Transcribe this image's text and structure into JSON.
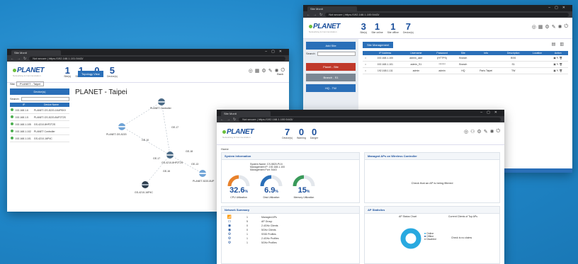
{
  "window1": {
    "tab_title": "Site Monit",
    "url": "Not secure | https://192.168.1.101:5443/",
    "logo": "PLANET",
    "logo_sub": "Networking & Communication",
    "stats": [
      {
        "num": "1",
        "label": "Site(s)"
      },
      {
        "num": "1",
        "label": "Site online"
      },
      {
        "num": "0",
        "label": "Site offline"
      },
      {
        "num": "5",
        "label": "Device(s)"
      }
    ],
    "topology_tab": "Topology View",
    "back_label": "Back",
    "site_label": "Site",
    "site_select": "PLANET - Taipei",
    "device_button": "Device(s)",
    "search_label": "Search",
    "table_headers": [
      "",
      "IP",
      "Device Name"
    ],
    "devices": [
      {
        "ip": "192.168.1.6",
        "name": "PLANET-GS-5220-16UP8XV"
      },
      {
        "ip": "192.168.1.5",
        "name": "PLANET-GS-5220-8UP2T2S"
      },
      {
        "ip": "192.168.1.105",
        "name": "GS-4210-8HP2T2S"
      },
      {
        "ip": "192.168.1.102",
        "name": "PLANET Controller"
      },
      {
        "ip": "192.168.1.101",
        "name": "GS-4210-16P4C"
      }
    ],
    "site_title": "PLANET - Taipei",
    "topo_nodes": [
      "PLANET-Controller",
      "PLANET-GS-5220",
      "GS-4210-8HP2T2S",
      "GS-4210-16P4C",
      "PLANET-5220-8UP"
    ],
    "topo_ports": [
      "GE-17",
      "GE-10",
      "GE-18",
      "GE-17",
      "GE-13",
      "GE-16"
    ]
  },
  "window2": {
    "tab_title": "Site Monit",
    "url": "Not secure | https://192.168.1.100:5443/",
    "logo": "PLANET",
    "logo_sub": "Networking & Communication",
    "stats": [
      {
        "num": "3",
        "label": "Site(s)"
      },
      {
        "num": "1",
        "label": "Site online"
      },
      {
        "num": "1",
        "label": "Site offline"
      },
      {
        "num": "7",
        "label": "Device(s)"
      }
    ],
    "side_add": "Add Site",
    "side_search": "Search",
    "side_buttons": [
      {
        "label": "Planet - Site",
        "color": "#c0392b"
      },
      {
        "label": "Branch - S1",
        "color": "#7b8794"
      },
      {
        "label": "HQ - TW",
        "color": "#2a6fb8"
      }
    ],
    "mgmt_tab": "Site Management",
    "table_headers": [
      "",
      "IP Address",
      "Username",
      "Password",
      "Site",
      "Info",
      "Description",
      "Location",
      "Action"
    ],
    "rows": [
      [
        "",
        "192.168.1.100",
        "admin_user",
        "(HTTPS)",
        "Branch",
        "",
        "BSS",
        "",
        ""
      ],
      [
        "",
        "192.168.1.101",
        "admin_S1",
        "*******",
        "Branch",
        "",
        "S1",
        "",
        ""
      ],
      [
        "",
        "192.168.1.111",
        "admin",
        "admin",
        "HQ",
        "Paris Taipei",
        "TW",
        "",
        ""
      ]
    ]
  },
  "window3": {
    "tab_title": "Site Monit",
    "url": "Not secure | https://192.168.1.100:5443/",
    "logo": "PLANET",
    "logo_sub": "Networking & Communication",
    "stats": [
      {
        "num": "7",
        "label": "Device(s)"
      },
      {
        "num": "0",
        "label": "Warning"
      },
      {
        "num": "0",
        "label": "Danger"
      }
    ],
    "crumb": "Home",
    "sys_panel": "System Information",
    "sys_info": [
      "System Name: CS-5820-PLN",
      "Management IP: 192.168.1.100",
      "Management Port: 5443"
    ],
    "gauges": [
      {
        "value": "32.6",
        "unit": "%",
        "label": "CPU Utilization",
        "pct": 0.326,
        "color": "#e8812a"
      },
      {
        "value": "6.9",
        "unit": "%",
        "label": "Disk Utilization",
        "pct": 0.069,
        "color": "#2a6fb8"
      },
      {
        "value": "15",
        "unit": "%",
        "label": "Memory Utilization",
        "pct": 0.15,
        "color": "#3a9a5a"
      }
    ],
    "ap_panel": "Managed APs on Wireless Controller",
    "ap_na": "Check that an AP is being filtered",
    "ns_panel": "Network Summary",
    "ns_rows": [
      {
        "icon": "wifi",
        "num": "1",
        "label": "Managed APs"
      },
      {
        "icon": "switch",
        "num": "5",
        "label": "AP Group"
      },
      {
        "icon": "user",
        "num": "0",
        "label": "2.4GHz Clients"
      },
      {
        "icon": "user",
        "num": "0",
        "label": "5GHz Clients"
      },
      {
        "icon": "gear",
        "num": "1",
        "label": "SSID Profiles"
      },
      {
        "icon": "gear",
        "num": "1",
        "label": "2.4GHz Profiles"
      },
      {
        "icon": "gear",
        "num": "1",
        "label": "5GHz Profiles"
      }
    ],
    "apstat_panel": "AP Statistics",
    "ap_status_chart": "AP Status Chart",
    "ap_current_clients": "Current Clients of Top APs",
    "ap_nodata": "Check is no claims",
    "legend": [
      "Online",
      "Offline",
      "Disabled"
    ]
  }
}
